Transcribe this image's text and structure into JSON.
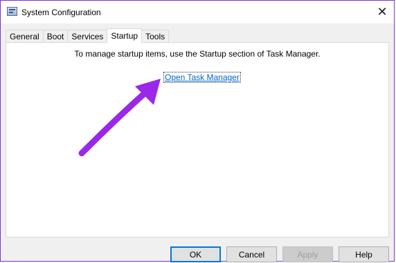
{
  "window": {
    "title": "System Configuration",
    "accent_color": "#7f2dd6"
  },
  "titlebar": {
    "app_icon": "msconfig-icon",
    "close_icon": "close-icon"
  },
  "tabs": [
    {
      "label": "General",
      "active": false
    },
    {
      "label": "Boot",
      "active": false
    },
    {
      "label": "Services",
      "active": false
    },
    {
      "label": "Startup",
      "active": true
    },
    {
      "label": "Tools",
      "active": false
    }
  ],
  "startup": {
    "message": "To manage startup items, use the Startup section of Task Manager.",
    "link_label": "Open Task Manager",
    "link_color": "#0066cc"
  },
  "annotation": {
    "type": "arrow",
    "color": "#9b27e8"
  },
  "buttons": {
    "ok": "OK",
    "cancel": "Cancel",
    "apply": "Apply",
    "help": "Help"
  }
}
